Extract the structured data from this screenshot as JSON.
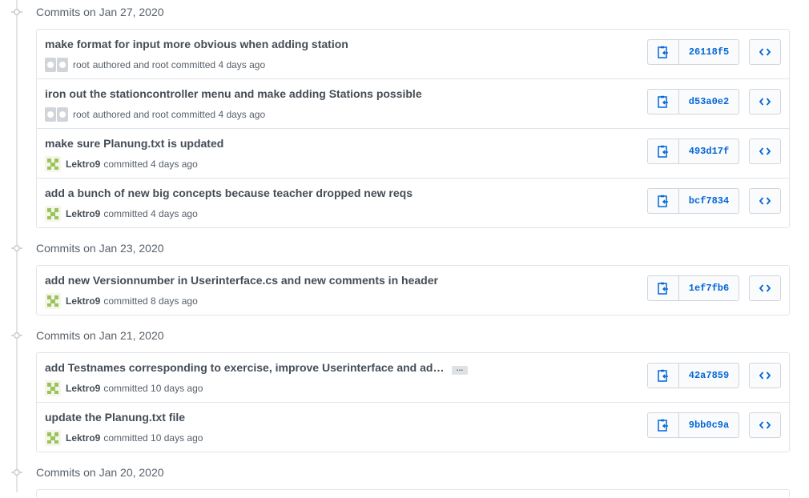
{
  "groups": [
    {
      "title": "Commits on Jan 27, 2020",
      "commits": [
        {
          "message": "make format for input more obvious when adding station",
          "author": "root",
          "verb": "authored and root committed 4 days ago",
          "sha": "26118f5",
          "avatar": "github"
        },
        {
          "message": "iron out the stationcontroller menu and make adding Stations possible",
          "author": "root",
          "verb": "authored and root committed 4 days ago",
          "sha": "d53a0e2",
          "avatar": "github"
        },
        {
          "message": "make sure Planung.txt is updated",
          "author": "Lektro9",
          "verb": "committed 4 days ago",
          "sha": "493d17f",
          "avatar": "identicon"
        },
        {
          "message": "add a bunch of new big concepts because teacher dropped new reqs",
          "author": "Lektro9",
          "verb": "committed 4 days ago",
          "sha": "bcf7834",
          "avatar": "identicon"
        }
      ]
    },
    {
      "title": "Commits on Jan 23, 2020",
      "commits": [
        {
          "message": "add new Versionnumber in Userinterface.cs and new comments in header",
          "author": "Lektro9",
          "verb": "committed 8 days ago",
          "sha": "1ef7fb6",
          "avatar": "identicon"
        }
      ]
    },
    {
      "title": "Commits on Jan 21, 2020",
      "commits": [
        {
          "message": "add Testnames corresponding to exercise, improve Userinterface and ad…",
          "author": "Lektro9",
          "verb": "committed 10 days ago",
          "sha": "42a7859",
          "avatar": "identicon",
          "has_ellipsis": true,
          "ellipsis_label": "…"
        },
        {
          "message": "update the Planung.txt file",
          "author": "Lektro9",
          "verb": "committed 10 days ago",
          "sha": "9bb0c9a",
          "avatar": "identicon"
        }
      ]
    },
    {
      "title": "Commits on Jan 20, 2020",
      "commits": []
    }
  ],
  "icons": {
    "copy": "clipboard-icon",
    "browse": "code-icon",
    "timeline": "commit-node-icon"
  },
  "colors": {
    "sha": "#0366d6",
    "identicon": "#9bc25c"
  }
}
